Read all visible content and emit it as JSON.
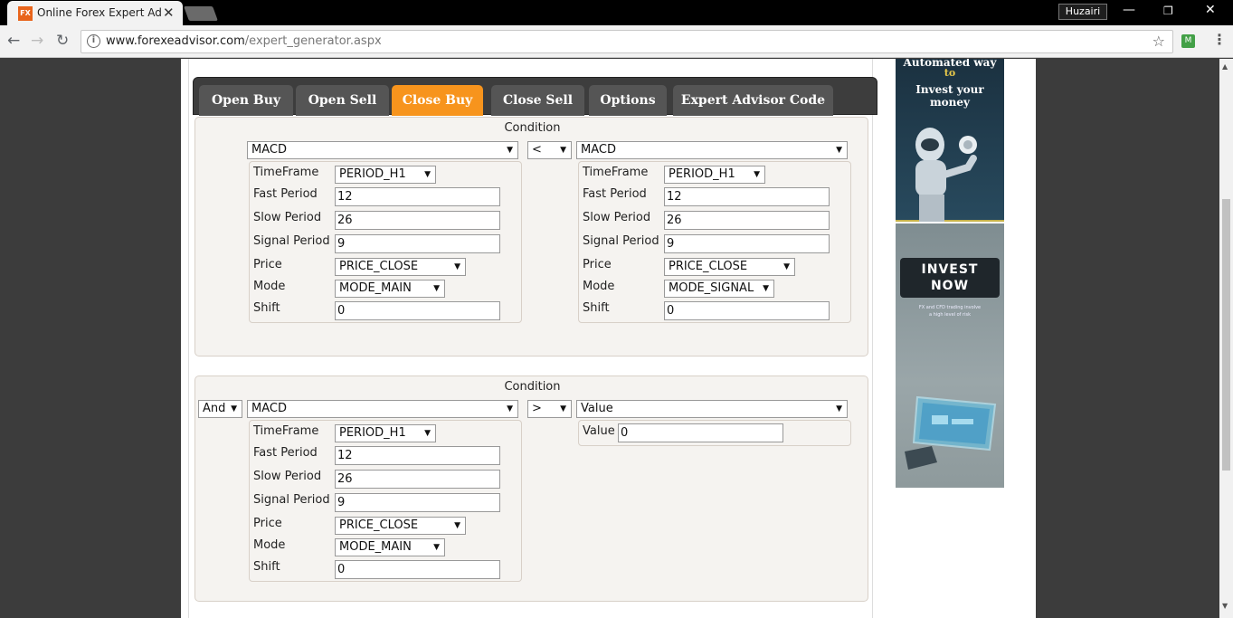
{
  "browser": {
    "tab_title": "Online Forex Expert Advi",
    "favicon_text": "FX",
    "tab_close": "✕",
    "user_name": "Huzairi",
    "url_host": "www.forexeadvisor.com",
    "url_path": "/expert_generator.aspx"
  },
  "tabs": [
    "Open Buy",
    "Open Sell",
    "Close Buy",
    "Close Sell",
    "Options",
    "Expert Advisor Code"
  ],
  "active_tab": "Close Buy",
  "labels": {
    "condition": "Condition",
    "timeframe": "TimeFrame",
    "fast_period": "Fast Period",
    "slow_period": "Slow Period",
    "signal_period": "Signal Period",
    "price": "Price",
    "mode": "Mode",
    "shift": "Shift",
    "value": "Value"
  },
  "condition1": {
    "left_indicator": "MACD",
    "operator": "<",
    "right_indicator": "MACD",
    "left": {
      "timeframe": "PERIOD_H1",
      "fast": "12",
      "slow": "26",
      "signal": "9",
      "price": "PRICE_CLOSE",
      "mode": "MODE_MAIN",
      "shift": "0"
    },
    "right": {
      "timeframe": "PERIOD_H1",
      "fast": "12",
      "slow": "26",
      "signal": "9",
      "price": "PRICE_CLOSE",
      "mode": "MODE_SIGNAL",
      "shift": "0"
    }
  },
  "condition2": {
    "logic": "And",
    "left_indicator": "MACD",
    "operator": ">",
    "right_indicator": "Value",
    "left": {
      "timeframe": "PERIOD_H1",
      "fast": "12",
      "slow": "26",
      "signal": "9",
      "price": "PRICE_CLOSE",
      "mode": "MODE_MAIN",
      "shift": "0"
    },
    "right_value": "0"
  },
  "ad": {
    "line1": "Automated way",
    "line2": "to",
    "line3": "Invest your money",
    "button_line1": "INVEST",
    "button_line2": "NOW",
    "disclaimer_line1": "FX and CFD trading involve",
    "disclaimer_line2": "a high level of risk"
  },
  "colors": {
    "active_tab": "#f7941d",
    "tab": "#555555",
    "tabbar": "#3d3d3d"
  }
}
